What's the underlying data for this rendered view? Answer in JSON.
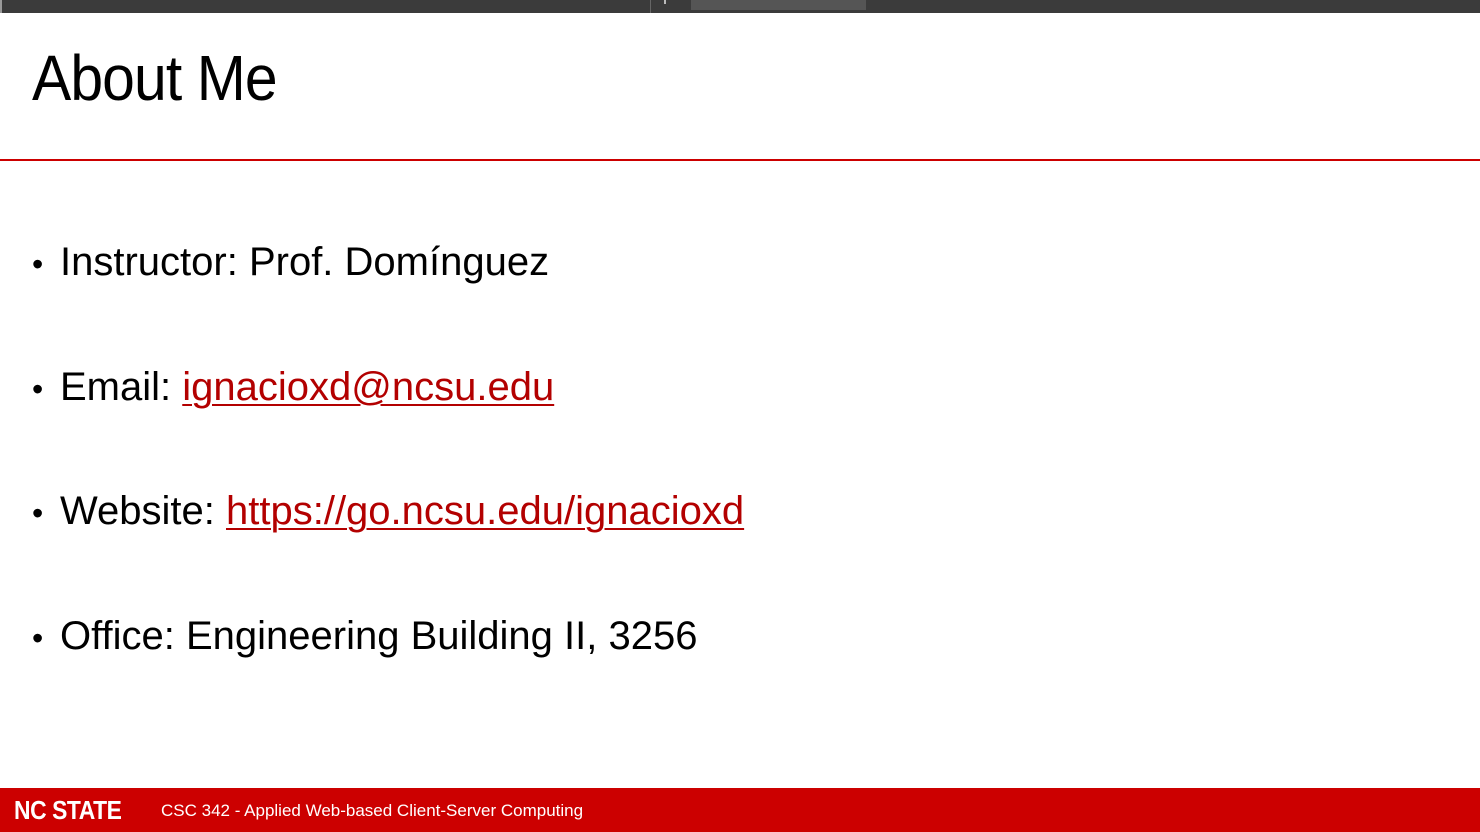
{
  "slide": {
    "title": "About Me",
    "accent_color": "#cc0000",
    "link_color": "#b30000",
    "items": [
      {
        "bullet": "•",
        "label": "Instructor: Prof. Domínguez",
        "link": ""
      },
      {
        "bullet": "•",
        "label": "Email: ",
        "link": "ignacioxd@ncsu.edu"
      },
      {
        "bullet": "•",
        "label": "Website: ",
        "link": "https://go.ncsu.edu/ignacioxd"
      },
      {
        "bullet": "•",
        "label": "Office: Engineering Building II, 3256",
        "link": ""
      }
    ]
  },
  "footer": {
    "logo": "NC STATE",
    "course": "CSC 342 - Applied Web-based Client-Server Computing"
  }
}
